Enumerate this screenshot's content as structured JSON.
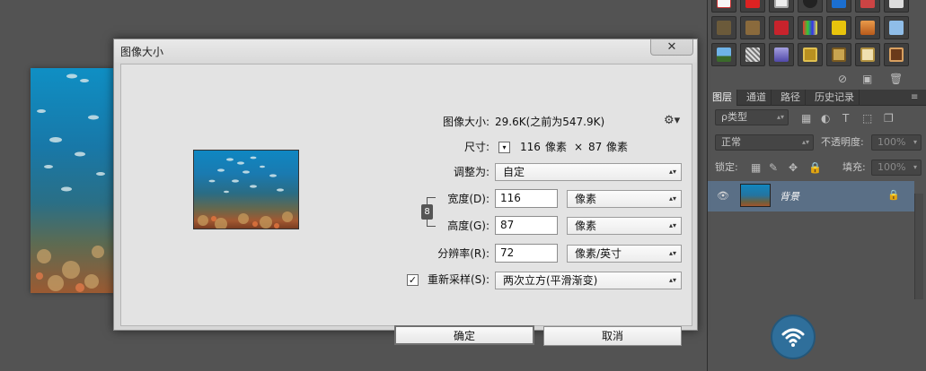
{
  "dialog": {
    "title": "图像大小",
    "close_glyph": "✕",
    "image_size_label": "图像大小:",
    "image_size_value": "29.6K(之前为547.9K)",
    "dimensions_label": "尺寸:",
    "dimensions_width": "116",
    "dimensions_unit": "像素",
    "dimensions_sep": "×",
    "dimensions_height": "87",
    "fit_to_label": "调整为:",
    "fit_to_value": "自定",
    "width_label": "宽度(D):",
    "width_value": "116",
    "width_unit": "像素",
    "height_label": "高度(G):",
    "height_value": "87",
    "height_unit": "像素",
    "resolution_label": "分辨率(R):",
    "resolution_value": "72",
    "resolution_unit": "像素/英寸",
    "resample_label": "重新采样(S):",
    "resample_checked": true,
    "resample_value": "两次立方(平滑渐变)",
    "ok_label": "确定",
    "cancel_label": "取消"
  },
  "layers_panel": {
    "tabs": [
      "图层",
      "通道",
      "路径",
      "历史记录"
    ],
    "filter_kind": "ρ类型",
    "blend_mode": "正常",
    "opacity_label": "不透明度:",
    "opacity_value": "100%",
    "lock_label": "锁定:",
    "fill_label": "填充:",
    "fill_value": "100%",
    "layer_name": "背景"
  },
  "colors": {
    "dialog_bg": "#d6d6d6",
    "panel_bg": "#535353",
    "selected_layer": "#5a6f86",
    "wifi_badge": "#2f6f9b"
  }
}
